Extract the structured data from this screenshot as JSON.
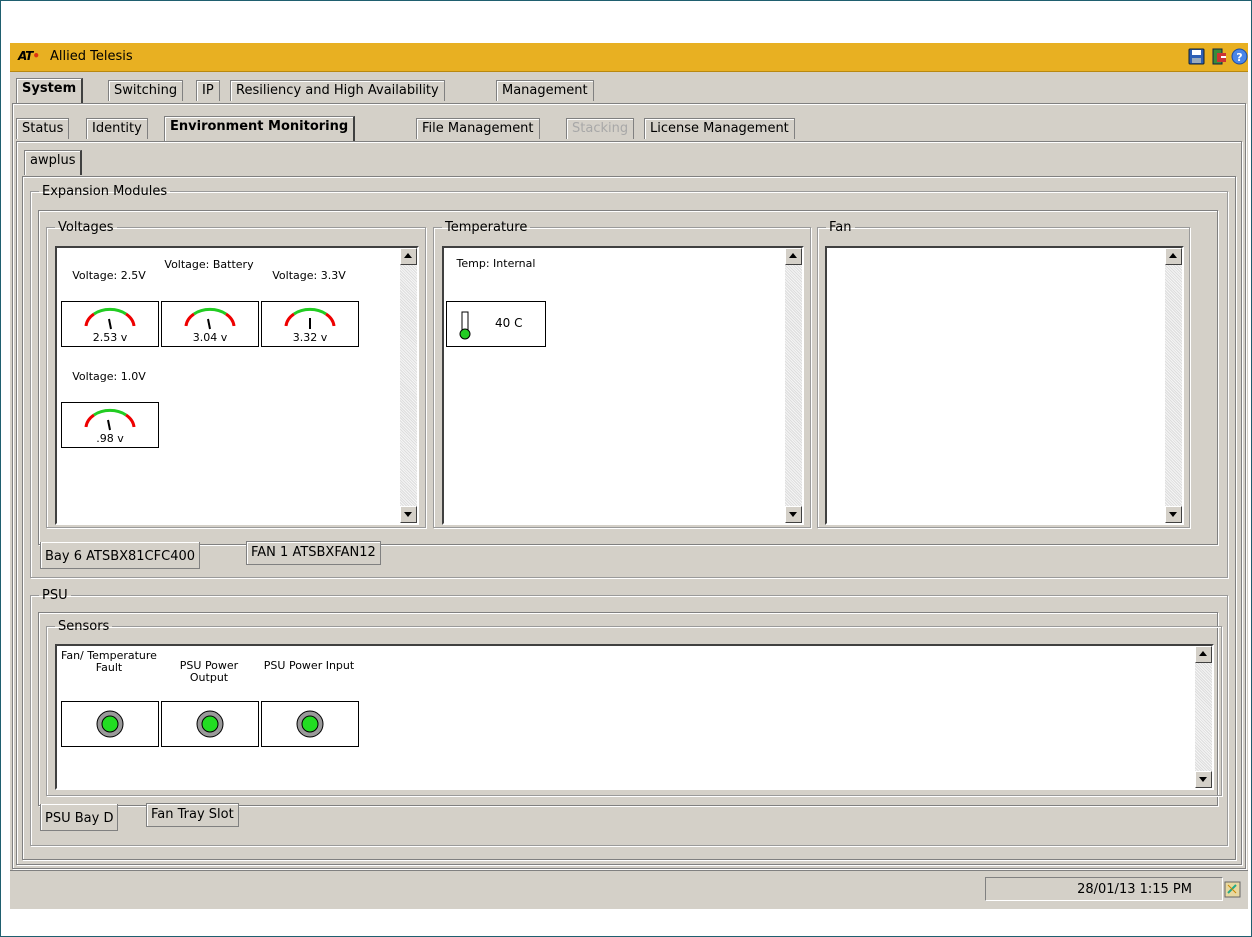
{
  "app": {
    "brand": "AT",
    "title": "Allied Telesis",
    "brand_color": "#e8b022"
  },
  "toolbar": {
    "save_icon": "save-icon",
    "exit_icon": "exit-icon",
    "help_icon": "help-icon"
  },
  "main_tabs": [
    {
      "label": "System",
      "active": true
    },
    {
      "label": "Switching"
    },
    {
      "label": "IP"
    },
    {
      "label": "Resiliency and High Availability"
    },
    {
      "label": "Management"
    }
  ],
  "sub_tabs": [
    {
      "label": "Status"
    },
    {
      "label": "Identity"
    },
    {
      "label": "Environment Monitoring",
      "active": true
    },
    {
      "label": "File Management"
    },
    {
      "label": "Stacking",
      "disabled": true
    },
    {
      "label": "License Management"
    }
  ],
  "device_tab": "awplus",
  "expansion": {
    "title": "Expansion Modules",
    "voltages": {
      "title": "Voltages",
      "gauges": [
        {
          "label": "Voltage: 2.5V",
          "value": "2.53 v"
        },
        {
          "label": "Voltage: Battery",
          "value": "3.04 v"
        },
        {
          "label": "Voltage: 3.3V",
          "value": "3.32 v"
        },
        {
          "label": "Voltage: 1.0V",
          "value": ".98 v"
        }
      ]
    },
    "temperature": {
      "title": "Temperature",
      "sensors": [
        {
          "label": "Temp: Internal",
          "value": "40 C"
        }
      ]
    },
    "fan": {
      "title": "Fan"
    },
    "tabs": [
      {
        "label": "Bay 6 ATSBX81CFC400",
        "active": true
      },
      {
        "label": "FAN 1 ATSBXFAN12"
      }
    ]
  },
  "psu": {
    "title": "PSU",
    "sensors": {
      "title": "Sensors",
      "items": [
        {
          "label": "Fan/ Temperature Fault",
          "status_color": "#22dd22"
        },
        {
          "label": "PSU Power Output",
          "status_color": "#22dd22"
        },
        {
          "label": "PSU Power Input",
          "status_color": "#22dd22"
        }
      ]
    },
    "tabs": [
      {
        "label": "PSU Bay D",
        "active": true
      },
      {
        "label": "Fan Tray Slot"
      }
    ]
  },
  "status": {
    "datetime": "28/01/13 1:15 PM"
  }
}
